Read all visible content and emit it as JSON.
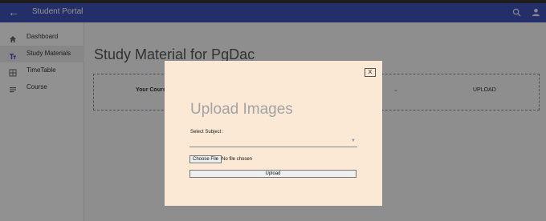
{
  "app": {
    "title": "Student Portal",
    "back_icon": "arrow-left-icon",
    "search_icon": "search-icon",
    "account_icon": "account-icon",
    "accent_color": "#3f51b5"
  },
  "sidebar": {
    "items": [
      {
        "label": "Dashboard",
        "icon": "home-icon",
        "active": false
      },
      {
        "label": "Study Materials",
        "icon": "text-icon",
        "active": true
      },
      {
        "label": "TimeTable",
        "icon": "grid-icon",
        "active": false
      },
      {
        "label": "Course",
        "icon": "list-icon",
        "active": false
      }
    ]
  },
  "main": {
    "page_title": "Study Material for PgDac",
    "course_label": "Your Course",
    "upload_label": "UPLOAD"
  },
  "modal": {
    "close_label": "X",
    "title": "Upload Images",
    "subject_label": "Select Subject :",
    "subject_value": "",
    "choose_file_label": "Choose File",
    "file_status": "No file chosen",
    "upload_button_label": "Upload",
    "background_color": "#fbe9d6"
  }
}
